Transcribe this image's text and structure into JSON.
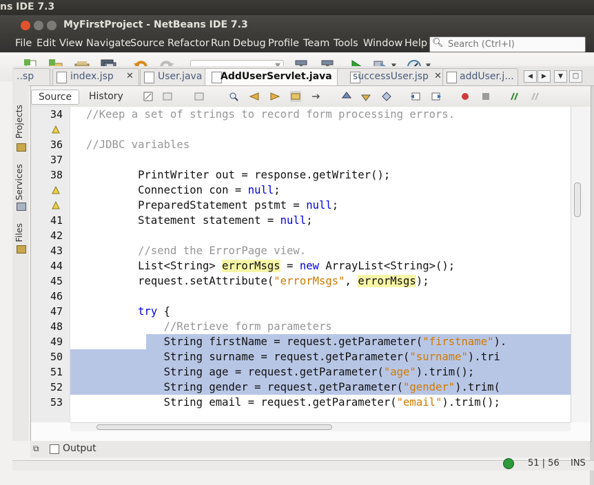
{
  "desktop": {
    "title_fragment": "ns IDE 7.3"
  },
  "window": {
    "title": "MyFirstProject - NetBeans IDE 7.3"
  },
  "menu": [
    "File",
    "Edit",
    "View",
    "Navigate",
    "Source",
    "Refactor",
    "Run",
    "Debug",
    "Profile",
    "Team",
    "Tools",
    "Window",
    "Help"
  ],
  "search": {
    "placeholder": "Search (Ctrl+I)"
  },
  "tabs": {
    "first_partial": "..sp",
    "items": [
      "index.jsp",
      "User.java",
      "AddUserServlet.java",
      "successUser.jsp",
      "addUser.j..."
    ],
    "active": "AddUserServlet.java"
  },
  "sidebar": {
    "items": [
      "Projects",
      "Services",
      "Files"
    ]
  },
  "editor": {
    "view_tabs": [
      "Source",
      "History"
    ],
    "line_numbers": [
      "34",
      "",
      "36",
      "37",
      "38",
      "",
      "",
      "41",
      "42",
      "43",
      "44",
      "45",
      "46",
      "47",
      "48",
      "49",
      "50",
      "51",
      "52",
      "53"
    ],
    "code_lines": [
      {
        "segs": [
          {
            "t": "//Keep a set of strings to record form processing errors.",
            "c": "cm"
          }
        ]
      },
      {
        "segs": [
          {
            "t": "",
            "c": ""
          }
        ]
      },
      {
        "segs": [
          {
            "t": "//JDBC variables",
            "c": "cm"
          }
        ]
      },
      {
        "segs": [
          {
            "t": "",
            "c": ""
          }
        ]
      },
      {
        "segs": [
          {
            "t": "        PrintWriter out = response.getWriter();",
            "c": ""
          }
        ]
      },
      {
        "segs": [
          {
            "t": "        Connection con = ",
            "c": ""
          },
          {
            "t": "null",
            "c": "kw"
          },
          {
            "t": ";",
            "c": ""
          }
        ]
      },
      {
        "segs": [
          {
            "t": "        PreparedStatement pstmt = ",
            "c": ""
          },
          {
            "t": "null",
            "c": "kw"
          },
          {
            "t": ";",
            "c": ""
          }
        ]
      },
      {
        "segs": [
          {
            "t": "        Statement statement = ",
            "c": ""
          },
          {
            "t": "null",
            "c": "kw"
          },
          {
            "t": ";",
            "c": ""
          }
        ]
      },
      {
        "segs": [
          {
            "t": "",
            "c": ""
          }
        ]
      },
      {
        "segs": [
          {
            "t": "        //send the ErrorPage view.",
            "c": "cm"
          }
        ]
      },
      {
        "segs": [
          {
            "t": "        List<String> ",
            "c": ""
          },
          {
            "t": "errorMsgs",
            "c": "fld"
          },
          {
            "t": " = ",
            "c": ""
          },
          {
            "t": "new",
            "c": "kw"
          },
          {
            "t": " ArrayList<String>();",
            "c": ""
          }
        ]
      },
      {
        "segs": [
          {
            "t": "        request.setAttribute(",
            "c": ""
          },
          {
            "t": "\"errorMsgs\"",
            "c": "st"
          },
          {
            "t": ", ",
            "c": ""
          },
          {
            "t": "errorMsgs",
            "c": "fld"
          },
          {
            "t": ");",
            "c": ""
          }
        ]
      },
      {
        "segs": [
          {
            "t": "",
            "c": ""
          }
        ]
      },
      {
        "segs": [
          {
            "t": "        ",
            "c": ""
          },
          {
            "t": "try",
            "c": "kw"
          },
          {
            "t": " {",
            "c": ""
          }
        ]
      },
      {
        "segs": [
          {
            "t": "            //Retrieve form parameters",
            "c": "cm"
          }
        ]
      },
      {
        "segs": [
          {
            "t": "            String firstName = request.getParameter(",
            "c": ""
          },
          {
            "t": "\"firstname\"",
            "c": "st"
          },
          {
            "t": ").",
            "c": ""
          }
        ]
      },
      {
        "segs": [
          {
            "t": "            String surname = request.getParameter(",
            "c": ""
          },
          {
            "t": "\"surname\"",
            "c": "st"
          },
          {
            "t": ").tri",
            "c": ""
          }
        ]
      },
      {
        "segs": [
          {
            "t": "            String age = request.getParameter(",
            "c": ""
          },
          {
            "t": "\"age\"",
            "c": "st"
          },
          {
            "t": ").trim();",
            "c": ""
          }
        ]
      },
      {
        "segs": [
          {
            "t": "            String gender = request.getParameter(",
            "c": ""
          },
          {
            "t": "\"gender\"",
            "c": "st"
          },
          {
            "t": ").trim(",
            "c": ""
          }
        ]
      },
      {
        "segs": [
          {
            "t": "            String email = request.getParameter(",
            "c": ""
          },
          {
            "t": "\"email\"",
            "c": "st"
          },
          {
            "t": ").trim();",
            "c": ""
          }
        ]
      }
    ],
    "selected_lines": [
      "49",
      "50",
      "51",
      "52"
    ]
  },
  "output": {
    "label": "Output"
  },
  "status": {
    "position": "51 | 56",
    "mode": "INS"
  },
  "colors": {
    "keyword": "#0000e6",
    "string": "#ce7b00",
    "comment": "#969696",
    "selection": "#b8c6e6",
    "field_highlight": "#f6f5a6"
  }
}
